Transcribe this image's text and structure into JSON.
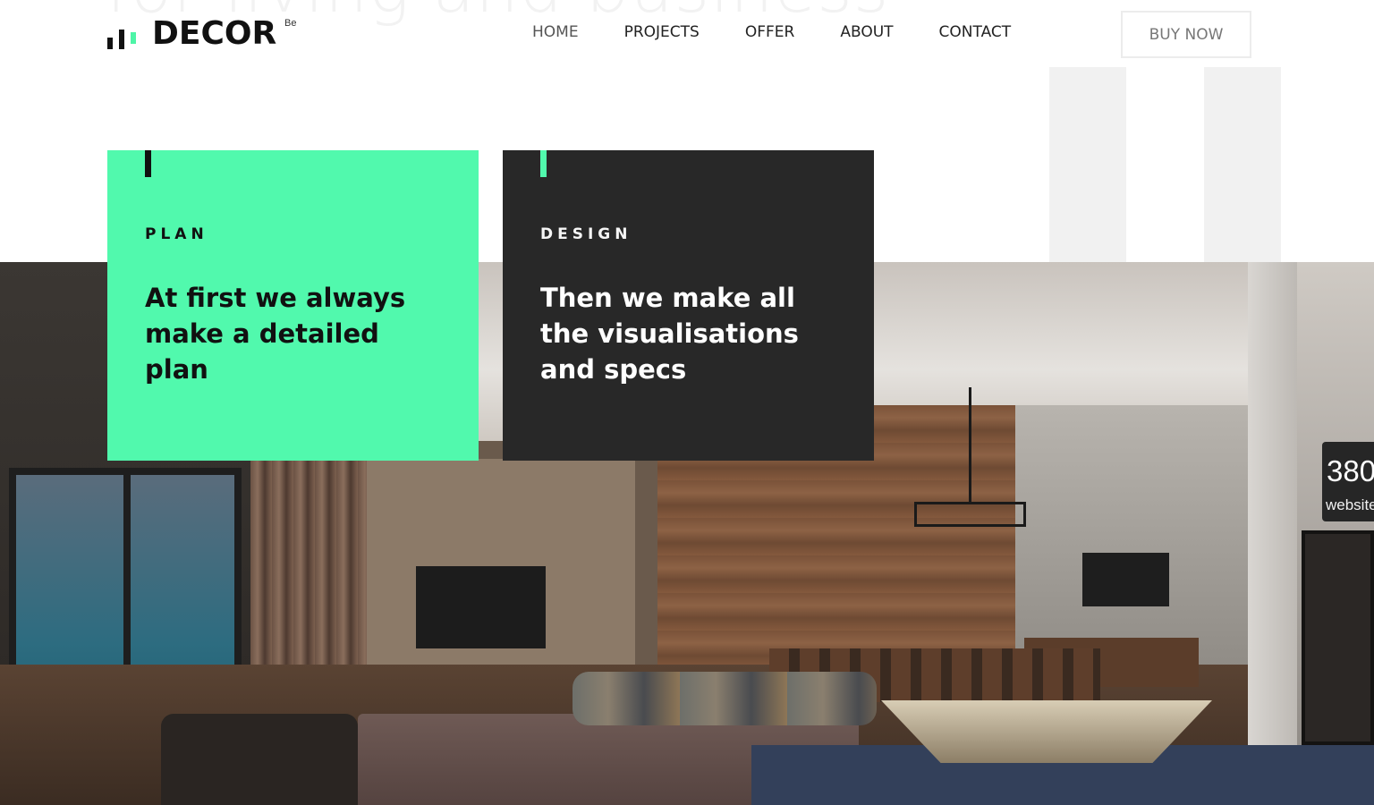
{
  "hero": {
    "ghost_heading": "for living and business"
  },
  "brand": {
    "name": "DECOR",
    "superscript": "Be"
  },
  "nav": {
    "items": [
      {
        "label": "HOME"
      },
      {
        "label": "PROJECTS"
      },
      {
        "label": "OFFER"
      },
      {
        "label": "ABOUT"
      },
      {
        "label": "CONTACT"
      }
    ],
    "cta_label": "BUY NOW"
  },
  "cards": [
    {
      "label": "PLAN",
      "text": "At first we always make a detailed plan",
      "color": "#51f9ad"
    },
    {
      "label": "DESIGN",
      "text": "Then we make all the visualisations and specs",
      "color": "#282828"
    }
  ],
  "badge": {
    "number": "380",
    "subtitle": "websites"
  },
  "colors": {
    "accent": "#51f9ad",
    "dark": "#282828",
    "text": "#111111"
  }
}
